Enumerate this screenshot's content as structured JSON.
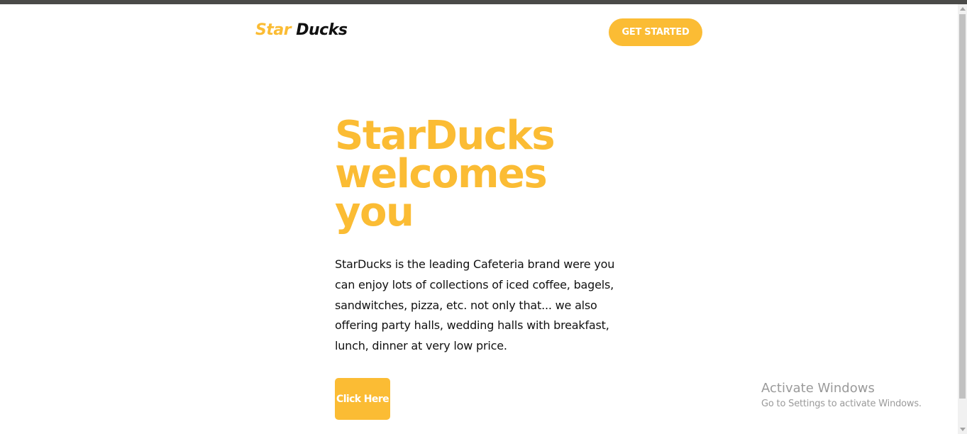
{
  "header": {
    "logo_part1": "Star",
    "logo_part2": "Ducks",
    "cta_label": "GET STARTED"
  },
  "hero": {
    "title_lines": [
      "StarDucks",
      "welcomes",
      "you"
    ],
    "description_lines": [
      "StarDucks is the leading Cafeteria brand were you",
      "can enjoy lots of collections of iced coffee, bagels,",
      "sandwitches, pizza, etc. not only that... we also",
      "offering party halls, wedding halls with breakfast,",
      "lunch, dinner at very low price."
    ],
    "button_label": "Click Here"
  },
  "watermark": {
    "title": "Activate Windows",
    "subtitle": "Go to Settings to activate Windows."
  },
  "colors": {
    "accent": "#fbbc34",
    "text": "#111111",
    "background": "#ffffff",
    "topbar": "#4a4a48",
    "watermark": "#9a9a9a"
  }
}
